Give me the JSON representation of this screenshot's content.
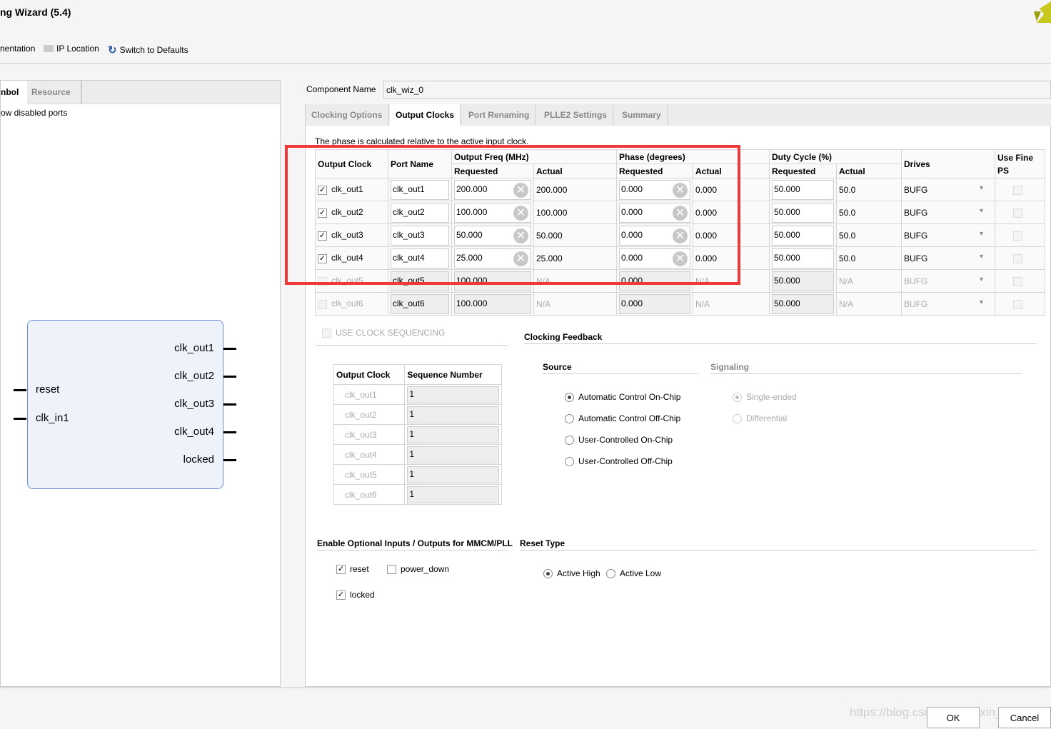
{
  "window": {
    "title": "ng Wizard (5.4)"
  },
  "toolbar": {
    "documentation": "nentation",
    "ip_location": "IP Location",
    "switch_defaults": "Switch to Defaults"
  },
  "left": {
    "tabs": [
      "nbol",
      "Resource"
    ],
    "show_disabled": "ow disabled ports",
    "symbol": {
      "inputs": [
        "reset",
        "clk_in1"
      ],
      "outputs": [
        "clk_out1",
        "clk_out2",
        "clk_out3",
        "clk_out4",
        "locked"
      ]
    }
  },
  "component": {
    "label": "Component Name",
    "value": "clk_wiz_0"
  },
  "tabs": [
    "Clocking Options",
    "Output Clocks",
    "Port Renaming",
    "PLLE2 Settings",
    "Summary"
  ],
  "active_tab": "Output Clocks",
  "note": "The phase is calculated relative to the active input clock.",
  "table": {
    "headers": {
      "output_clock": "Output Clock",
      "port_name": "Port Name",
      "freq": "Output Freq (MHz)",
      "phase": "Phase (degrees)",
      "duty": "Duty Cycle (%)",
      "requested": "Requested",
      "actual": "Actual",
      "drives": "Drives",
      "fine_ps": "Use Fine PS"
    },
    "rows": [
      {
        "enabled": true,
        "checked": true,
        "name": "clk_out1",
        "port": "clk_out1",
        "freq_req": "200.000",
        "freq_act": "200.000",
        "phase_req": "0.000",
        "phase_act": "0.000",
        "duty_req": "50.000",
        "duty_act": "50.0",
        "drives": "BUFG"
      },
      {
        "enabled": true,
        "checked": true,
        "name": "clk_out2",
        "port": "clk_out2",
        "freq_req": "100.000",
        "freq_act": "100.000",
        "phase_req": "0.000",
        "phase_act": "0.000",
        "duty_req": "50.000",
        "duty_act": "50.0",
        "drives": "BUFG"
      },
      {
        "enabled": true,
        "checked": true,
        "name": "clk_out3",
        "port": "clk_out3",
        "freq_req": "50.000",
        "freq_act": "50.000",
        "phase_req": "0.000",
        "phase_act": "0.000",
        "duty_req": "50.000",
        "duty_act": "50.0",
        "drives": "BUFG"
      },
      {
        "enabled": true,
        "checked": true,
        "name": "clk_out4",
        "port": "clk_out4",
        "freq_req": "25.000",
        "freq_act": "25.000",
        "phase_req": "0.000",
        "phase_act": "0.000",
        "duty_req": "50.000",
        "duty_act": "50.0",
        "drives": "BUFG"
      },
      {
        "enabled": false,
        "checked": false,
        "name": "clk_out5",
        "port": "clk_out5",
        "freq_req": "100.000",
        "freq_act": "N/A",
        "phase_req": "0.000",
        "phase_act": "N/A",
        "duty_req": "50.000",
        "duty_act": "N/A",
        "drives": "BUFG"
      },
      {
        "enabled": false,
        "checked": false,
        "name": "clk_out6",
        "port": "clk_out6",
        "freq_req": "100.000",
        "freq_act": "N/A",
        "phase_req": "0.000",
        "phase_act": "N/A",
        "duty_req": "50.000",
        "duty_act": "N/A",
        "drives": "BUFG"
      }
    ]
  },
  "sequencing": {
    "label": "USE CLOCK SEQUENCING",
    "headers": [
      "Output Clock",
      "Sequence Number"
    ],
    "rows": [
      [
        "clk_out1",
        "1"
      ],
      [
        "clk_out2",
        "1"
      ],
      [
        "clk_out3",
        "1"
      ],
      [
        "clk_out4",
        "1"
      ],
      [
        "clk_out5",
        "1"
      ],
      [
        "clk_out6",
        "1"
      ]
    ]
  },
  "feedback": {
    "title": "Clocking Feedback",
    "source_label": "Source",
    "signaling_label": "Signaling",
    "sources": [
      "Automatic Control On-Chip",
      "Automatic Control Off-Chip",
      "User-Controlled On-Chip",
      "User-Controlled Off-Chip"
    ],
    "selected_source": "Automatic Control On-Chip",
    "signaling": [
      "Single-ended",
      "Differential"
    ],
    "selected_signaling": "Single-ended"
  },
  "optional": {
    "title": "Enable Optional Inputs / Outputs for MMCM/PLL",
    "reset": "reset",
    "power_down": "power_down",
    "locked": "locked",
    "reset_checked": true,
    "power_down_checked": false,
    "locked_checked": true
  },
  "reset_type": {
    "title": "Reset Type",
    "options": [
      "Active High",
      "Active Low"
    ],
    "selected": "Active High"
  },
  "buttons": {
    "ok": "OK",
    "cancel": "Cancel"
  },
  "watermark": "https://blog.csdn.net/weixin_42066185",
  "colors": {
    "highlight": "#f03a3a",
    "symbol_border": "#6a8ccc"
  }
}
